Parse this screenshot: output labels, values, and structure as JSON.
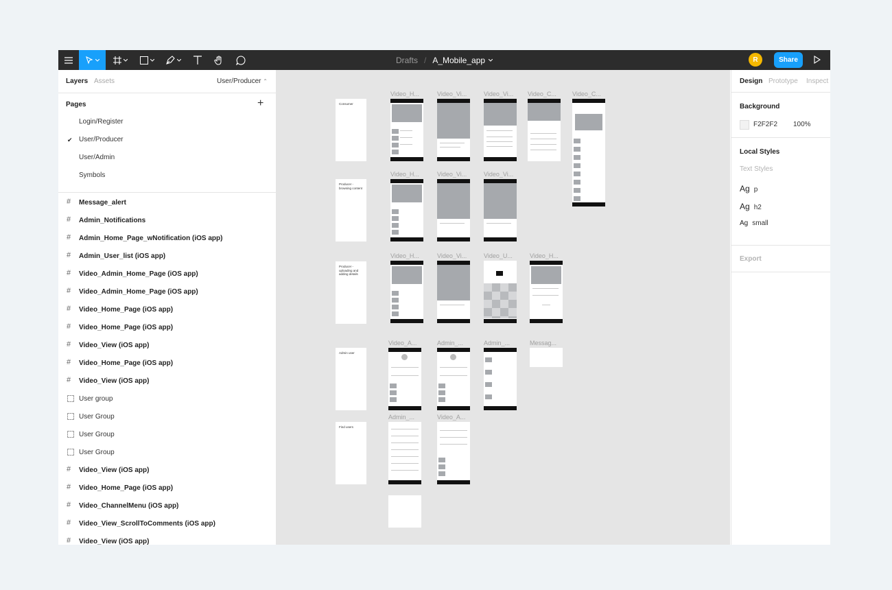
{
  "toolbar": {
    "menu_icon": "hamburger-icon",
    "tools": [
      "move-tool-icon",
      "frame-tool-icon",
      "shape-tool-icon",
      "pen-tool-icon",
      "text-tool-icon",
      "hand-tool-icon",
      "comment-tool-icon"
    ],
    "breadcrumb": "Drafts",
    "separator": "/",
    "file_name": "A_Mobile_app",
    "avatar_initial": "R",
    "avatar_color": "#f5b800",
    "share_label": "Share",
    "accent_color": "#18a0fb"
  },
  "left_panel": {
    "tabs": [
      {
        "label": "Layers",
        "active": true
      },
      {
        "label": "Assets",
        "active": false
      }
    ],
    "current_page": "User/Producer",
    "pages_header": "Pages",
    "pages": [
      {
        "label": "Login/Register",
        "selected": false
      },
      {
        "label": "User/Producer",
        "selected": true
      },
      {
        "label": "User/Admin",
        "selected": false
      },
      {
        "label": "Symbols",
        "selected": false
      }
    ],
    "layers": [
      {
        "label": "Message_alert",
        "type": "frame"
      },
      {
        "label": "Admin_Notifications",
        "type": "frame"
      },
      {
        "label": "Admin_Home_Page_wNotification (iOS app)",
        "type": "frame"
      },
      {
        "label": "Admin_User_list (iOS app)",
        "type": "frame"
      },
      {
        "label": "Video_Admin_Home_Page (iOS app)",
        "type": "frame"
      },
      {
        "label": "Video_Admin_Home_Page (iOS app)",
        "type": "frame"
      },
      {
        "label": "Video_Home_Page (iOS app)",
        "type": "frame"
      },
      {
        "label": "Video_Home_Page (iOS app)",
        "type": "frame"
      },
      {
        "label": "Video_View (iOS app)",
        "type": "frame"
      },
      {
        "label": "Video_Home_Page (iOS app)",
        "type": "frame"
      },
      {
        "label": "Video_View (iOS app)",
        "type": "frame"
      },
      {
        "label": "User group",
        "type": "group"
      },
      {
        "label": "User Group",
        "type": "group"
      },
      {
        "label": "User Group",
        "type": "group"
      },
      {
        "label": "User Group",
        "type": "group"
      },
      {
        "label": "Video_View (iOS app)",
        "type": "frame"
      },
      {
        "label": "Video_Home_Page (iOS app)",
        "type": "frame"
      },
      {
        "label": "Video_ChannelMenu (iOS app)",
        "type": "frame"
      },
      {
        "label": "Video_View_ScrollToComments (iOS app)",
        "type": "frame"
      },
      {
        "label": "Video_View (iOS app)",
        "type": "frame"
      }
    ]
  },
  "canvas": {
    "background": "#e5e5e5",
    "section_labels": {
      "consumer": "Consumer",
      "producer_browsing": "Producer - browsing content",
      "producer_uploading": "Producer - uploading and adding details",
      "admin_user": "Admin user",
      "find_users": "Find users"
    },
    "frame_labels": {
      "r1": [
        "Video_H...",
        "Video_Vi...",
        "Video_Vi...",
        "Video_C...",
        "Video_C..."
      ],
      "r2": [
        "Video_H...",
        "Video_Vi...",
        "Video_Vi..."
      ],
      "r3": [
        "Video_H...",
        "Video_Vi...",
        "Video_U...",
        "Video_H..."
      ],
      "r4": [
        "Video_A...",
        "Admin_...",
        "Admin_...",
        "Messag..."
      ],
      "r5": [
        "Admin_...",
        "Video_A..."
      ]
    }
  },
  "right_panel": {
    "tabs": [
      {
        "label": "Design",
        "active": true
      },
      {
        "label": "Prototype",
        "active": false
      },
      {
        "label": "Inspect",
        "active": false
      }
    ],
    "background_header": "Background",
    "background_hex": "F2F2F2",
    "background_opacity": "100%",
    "local_styles_header": "Local Styles",
    "text_styles_header": "Text Styles",
    "text_styles": [
      {
        "sample": "Ag",
        "name": "p"
      },
      {
        "sample": "Ag",
        "name": "h2"
      },
      {
        "sample": "Ag",
        "name": "small"
      }
    ],
    "export_header": "Export"
  }
}
